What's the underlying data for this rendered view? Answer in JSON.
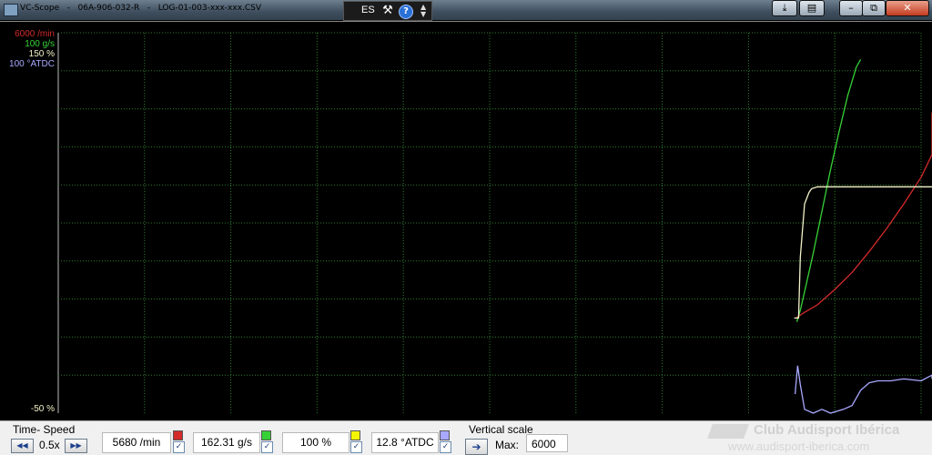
{
  "window": {
    "title": "VC-Scope   -   06A-906-032-R   -   LOG-01-003-xxx-xxx.CSV",
    "language": "ES",
    "help_glyph": "?",
    "tools_icon": "wrench-screwdriver-icon",
    "buttons": {
      "upload": "⤓",
      "panel": "▤",
      "minimize": "–",
      "restore": "⧉",
      "close": "✕"
    }
  },
  "scales": {
    "rpm_max": "6000 /min",
    "maf_max": "100 g/s",
    "load_max": "150 %",
    "timing_max": "100 °ATDC",
    "min": "-50 %"
  },
  "colors": {
    "rpm": "#d42a2a",
    "maf": "#36d236",
    "load": "#f2f2c8",
    "timing": "#a8a8ff",
    "grid": "#2e7d2e"
  },
  "chart_data": {
    "type": "line",
    "x_unit": "sample",
    "xlim": [
      0,
      100
    ],
    "ylim": [
      -50,
      150
    ],
    "series": [
      {
        "key": "rpm",
        "points": [
          [
            85.5,
            0
          ],
          [
            86.5,
            3
          ],
          [
            88,
            7
          ],
          [
            90,
            15
          ],
          [
            92,
            24
          ],
          [
            94,
            35
          ],
          [
            96,
            47
          ],
          [
            98,
            60
          ],
          [
            100,
            74
          ],
          [
            102,
            86
          ],
          [
            104,
            97
          ],
          [
            106.5,
            108
          ]
        ]
      },
      {
        "key": "maf",
        "points": [
          [
            85.6,
            -2
          ],
          [
            86,
            4
          ],
          [
            86.6,
            16
          ],
          [
            87.5,
            34
          ],
          [
            88.5,
            56
          ],
          [
            89.5,
            78
          ],
          [
            90.5,
            98
          ],
          [
            91.5,
            117
          ],
          [
            92.5,
            132
          ],
          [
            93,
            136
          ]
        ]
      },
      {
        "key": "load",
        "points": [
          [
            85.3,
            0
          ],
          [
            85.8,
            0
          ],
          [
            86,
            32
          ],
          [
            86.5,
            60
          ],
          [
            87,
            66
          ],
          [
            87.3,
            68
          ],
          [
            88,
            69
          ],
          [
            100,
            69
          ],
          [
            106.5,
            69
          ]
        ]
      },
      {
        "key": "timing",
        "points": [
          [
            85.4,
            -40
          ],
          [
            85.7,
            -25
          ],
          [
            86,
            -35
          ],
          [
            86.5,
            -48
          ],
          [
            87.5,
            -50
          ],
          [
            88.5,
            -48
          ],
          [
            89.5,
            -50
          ],
          [
            91,
            -48
          ],
          [
            92,
            -46
          ],
          [
            93,
            -38
          ],
          [
            94,
            -34
          ],
          [
            95,
            -33
          ],
          [
            96.5,
            -33
          ],
          [
            98,
            -32
          ],
          [
            100,
            -33
          ],
          [
            102,
            -30
          ],
          [
            104,
            -31
          ],
          [
            106.5,
            -32
          ]
        ]
      }
    ]
  },
  "panel": {
    "time_speed_label": "Time- Speed",
    "speed_value": "0.5x",
    "rew_glyph": "◀◀",
    "fwd_glyph": "▶▶",
    "readouts": [
      {
        "value": "5680 /min",
        "checked": "✓"
      },
      {
        "value": "162.31 g/s",
        "checked": "✓"
      },
      {
        "value": "100 %",
        "checked": "✓"
      },
      {
        "value": "12.8 °ATDC",
        "checked": "✓"
      }
    ],
    "vertical_scale_label": "Vertical scale",
    "arrow_glyph": "➔",
    "max_label": "Max:",
    "max_value": "6000"
  },
  "watermark": {
    "line1": "Club Audisport Ibérica",
    "line2": "www.audisport-iberica.com"
  }
}
